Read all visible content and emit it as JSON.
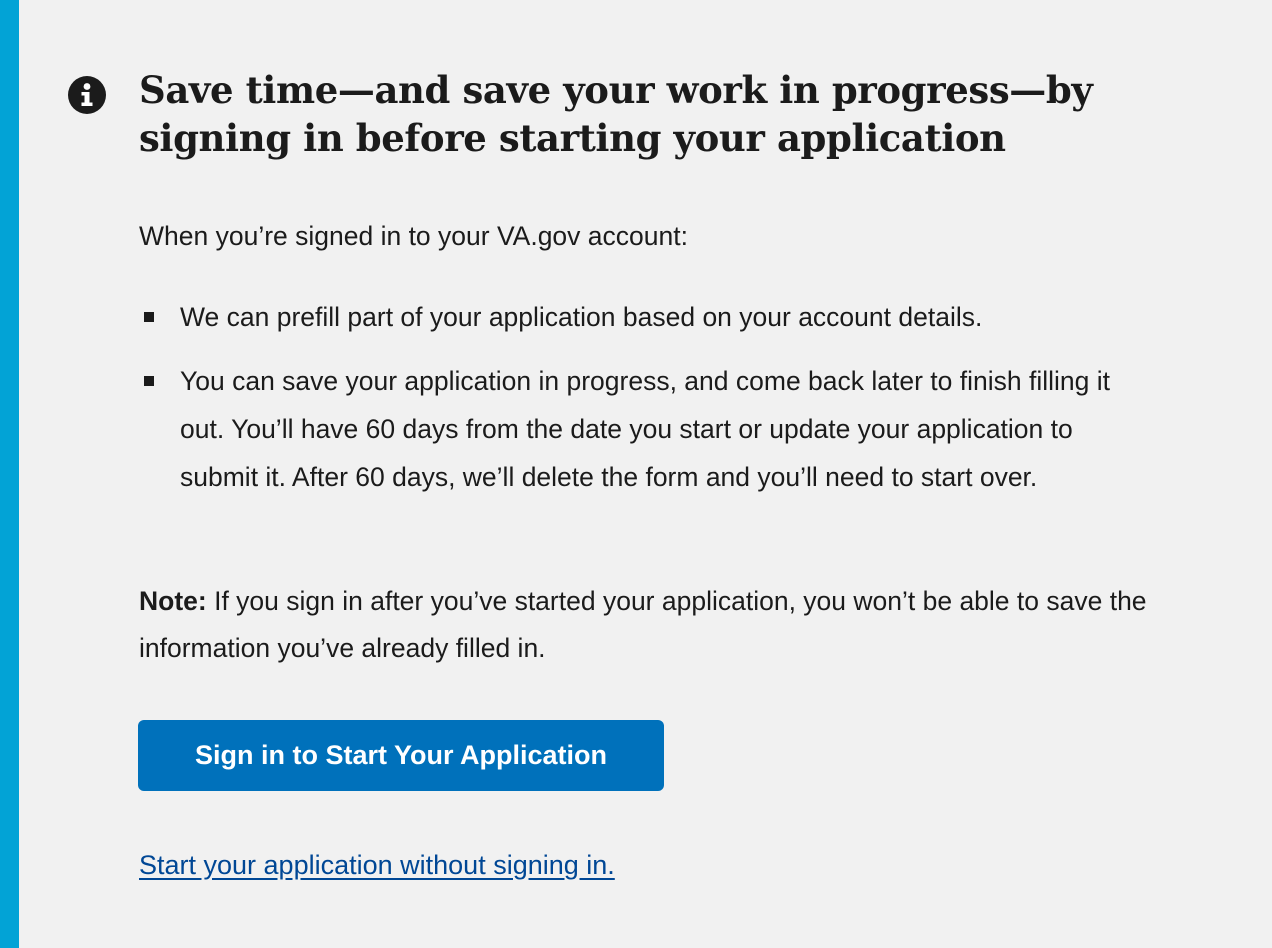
{
  "alert": {
    "accent_color": "#02a3d6",
    "icon": "info-circle-icon",
    "heading": "Save time—and save your work in progress—by signing in before starting your application",
    "intro": "When you’re signed in to your VA.gov account:",
    "bullets": [
      "We can prefill part of your application based on your account details.",
      "You can save your application in progress, and come back later to finish filling it out. You’ll have 60 days from the date you start or update your application to submit it. After 60 days, we’ll delete the form and you’ll need to start over."
    ],
    "note_label": "Note:",
    "note_text": " If you sign in after you’ve started your application, you won’t be able to save the information you’ve already filled in.",
    "sign_in_button": {
      "label": "Sign in to Start Your Application",
      "color": "#0071bb"
    },
    "start_link": {
      "label": "Start your application without signing in.",
      "color": "#004795"
    }
  }
}
